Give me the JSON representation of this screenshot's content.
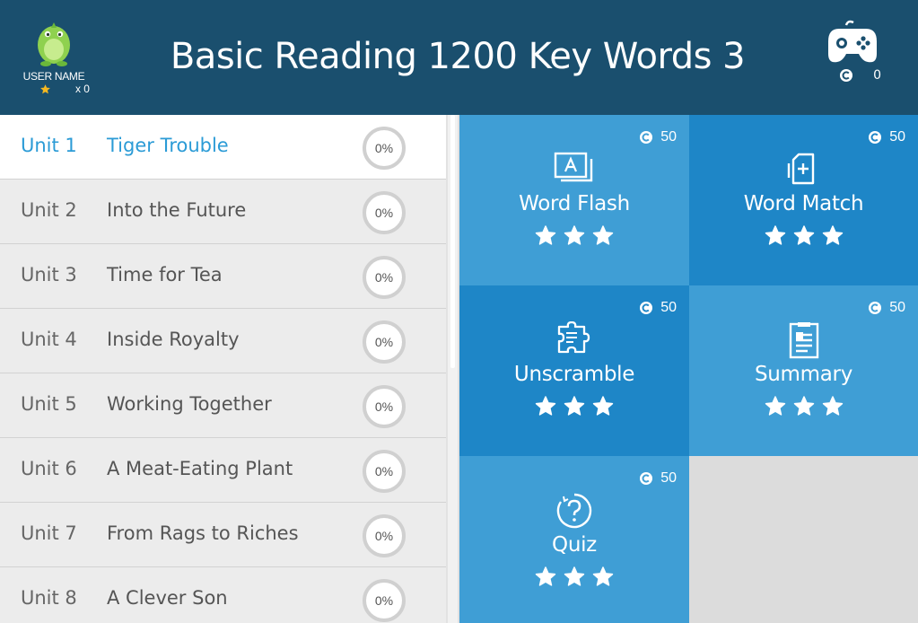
{
  "header": {
    "title": "Basic Reading 1200 Key Words 3",
    "user_name": "USER NAME",
    "star_count": "x 0",
    "coin_count": "0"
  },
  "units": [
    {
      "label": "Unit 1",
      "title": "Tiger Trouble",
      "progress": "0%",
      "active": true
    },
    {
      "label": "Unit 2",
      "title": "Into the Future",
      "progress": "0%"
    },
    {
      "label": "Unit 3",
      "title": "Time for Tea",
      "progress": "0%"
    },
    {
      "label": "Unit 4",
      "title": "Inside Royalty",
      "progress": "0%"
    },
    {
      "label": "Unit 5",
      "title": "Working Together",
      "progress": "0%"
    },
    {
      "label": "Unit 6",
      "title": "A Meat-Eating Plant",
      "progress": "0%"
    },
    {
      "label": "Unit 7",
      "title": "From Rags to Riches",
      "progress": "0%"
    },
    {
      "label": "Unit 8",
      "title": "A Clever Son",
      "progress": "0%"
    }
  ],
  "activities": [
    {
      "name": "Word Flash",
      "coins": "50",
      "icon": "flashcard-icon",
      "stars": 3
    },
    {
      "name": "Word Match",
      "coins": "50",
      "icon": "match-cards-icon",
      "stars": 3
    },
    {
      "name": "Unscramble",
      "coins": "50",
      "icon": "puzzle-icon",
      "stars": 3
    },
    {
      "name": "Summary",
      "coins": "50",
      "icon": "document-icon",
      "stars": 3
    },
    {
      "name": "Quiz",
      "coins": "50",
      "icon": "question-icon",
      "stars": 3
    }
  ],
  "colors": {
    "header_bg": "#1a4f6e",
    "tile_light": "#3f9ed5",
    "tile_dark": "#1e86c7",
    "active_text": "#2b9bd6",
    "mascot_green": "#8fd14f"
  }
}
